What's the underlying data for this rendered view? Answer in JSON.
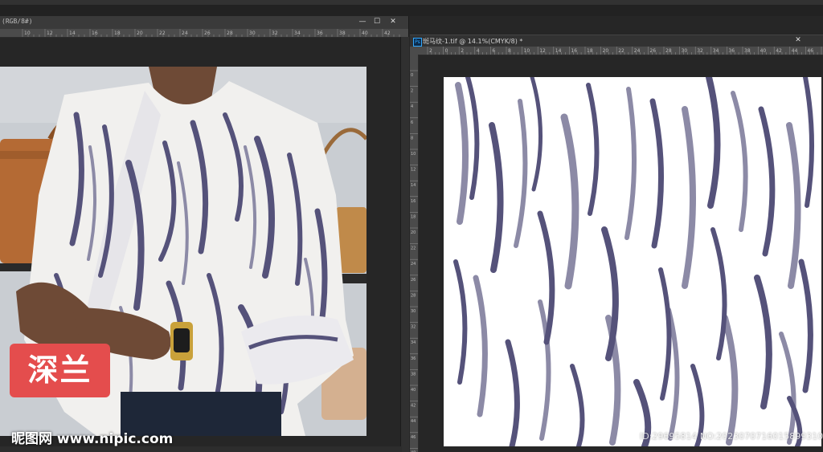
{
  "window_left": {
    "title": "(RGB/8#)",
    "controls": {
      "minimize": "—",
      "maximize": "☐",
      "close": "✕"
    },
    "ruler_labels": [
      "10",
      "12",
      "14",
      "16",
      "18",
      "20",
      "22",
      "24",
      "26",
      "28",
      "30",
      "32",
      "34",
      "36",
      "38",
      "40",
      "42"
    ]
  },
  "window_right": {
    "title": "斑马纹-1.tif @ 14.1%(CMYK/8) *",
    "ps_badge": "Ps",
    "controls": {
      "close": "✕"
    },
    "ruler_labels": [
      "2",
      "0",
      "2",
      "4",
      "6",
      "8",
      "10",
      "12",
      "14",
      "16",
      "18",
      "20",
      "22",
      "24",
      "26",
      "28",
      "30",
      "32",
      "34",
      "36",
      "38",
      "40",
      "42",
      "44",
      "46",
      "48"
    ],
    "vruler_labels": [
      "0",
      "2",
      "4",
      "6",
      "8",
      "10",
      "12",
      "14",
      "16",
      "18",
      "20",
      "22",
      "24",
      "26",
      "28",
      "30",
      "32",
      "34",
      "36",
      "38",
      "40",
      "42",
      "44",
      "46",
      "48"
    ]
  },
  "badge": {
    "text": "深兰",
    "color": "#e44d4d"
  },
  "watermark": {
    "text": "昵图网 www.nipic.com"
  },
  "image_id": {
    "text": "ID:29695814 NO:20230707160158993100"
  },
  "colors": {
    "stripe_dark": "#55527a",
    "stripe_light": "#8c8aa6",
    "blouse": "#f1f0ee",
    "wall": "#c9cdd2"
  }
}
